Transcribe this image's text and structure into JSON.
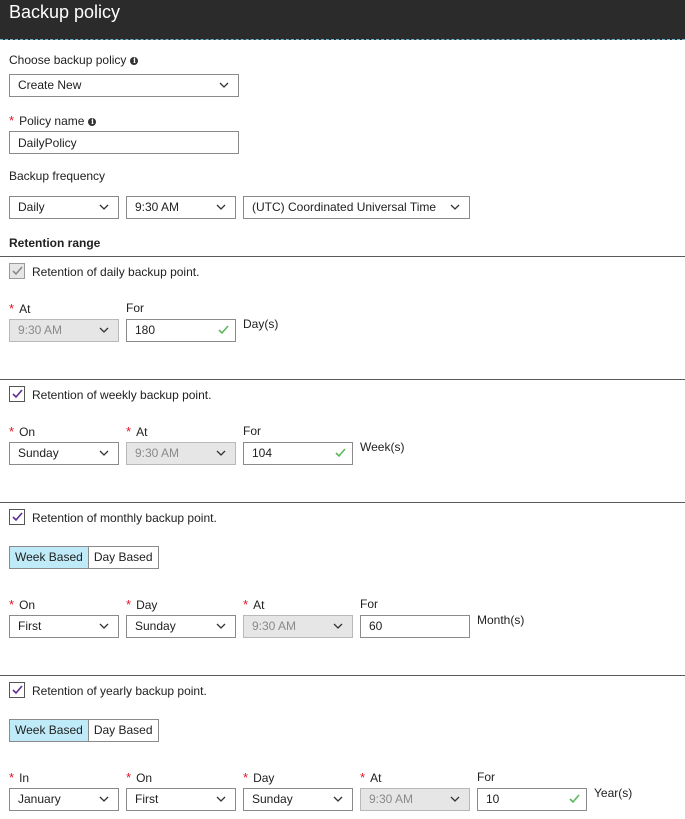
{
  "header": {
    "title": "Backup policy"
  },
  "policy": {
    "choose_label": "Choose backup policy",
    "choose_value": "Create New",
    "name_label": "Policy name",
    "name_value": "DailyPolicy"
  },
  "frequency": {
    "label": "Backup frequency",
    "period": "Daily",
    "time": "9:30 AM",
    "timezone": "(UTC) Coordinated Universal Time"
  },
  "retention": {
    "heading": "Retention range",
    "daily": {
      "checkbox_label": "Retention of daily backup point.",
      "checked": true,
      "at_label": "At",
      "at_value": "9:30 AM",
      "for_label": "For",
      "for_value": "180",
      "unit": "Day(s)"
    },
    "weekly": {
      "checkbox_label": "Retention of weekly backup point.",
      "checked": true,
      "on_label": "On",
      "on_value": "Sunday",
      "at_label": "At",
      "at_value": "9:30 AM",
      "for_label": "For",
      "for_value": "104",
      "unit": "Week(s)"
    },
    "monthly": {
      "checkbox_label": "Retention of monthly backup point.",
      "checked": true,
      "toggle": {
        "week_based": "Week Based",
        "day_based": "Day Based",
        "selected": "week_based"
      },
      "on_label": "On",
      "on_value": "First",
      "day_label": "Day",
      "day_value": "Sunday",
      "at_label": "At",
      "at_value": "9:30 AM",
      "for_label": "For",
      "for_value": "60",
      "unit": "Month(s)"
    },
    "yearly": {
      "checkbox_label": "Retention of yearly backup point.",
      "checked": true,
      "toggle": {
        "week_based": "Week Based",
        "day_based": "Day Based",
        "selected": "week_based"
      },
      "in_label": "In",
      "in_value": "January",
      "on_label": "On",
      "on_value": "First",
      "day_label": "Day",
      "day_value": "Sunday",
      "at_label": "At",
      "at_value": "9:30 AM",
      "for_label": "For",
      "for_value": "10",
      "unit": "Year(s)"
    }
  },
  "colors": {
    "header_bg": "#2b2b2b",
    "required": "#e81123",
    "valid_check": "#5cb85c",
    "toggle_active": "#bfeaf8",
    "checkbox_mark": "#5c2d91"
  }
}
